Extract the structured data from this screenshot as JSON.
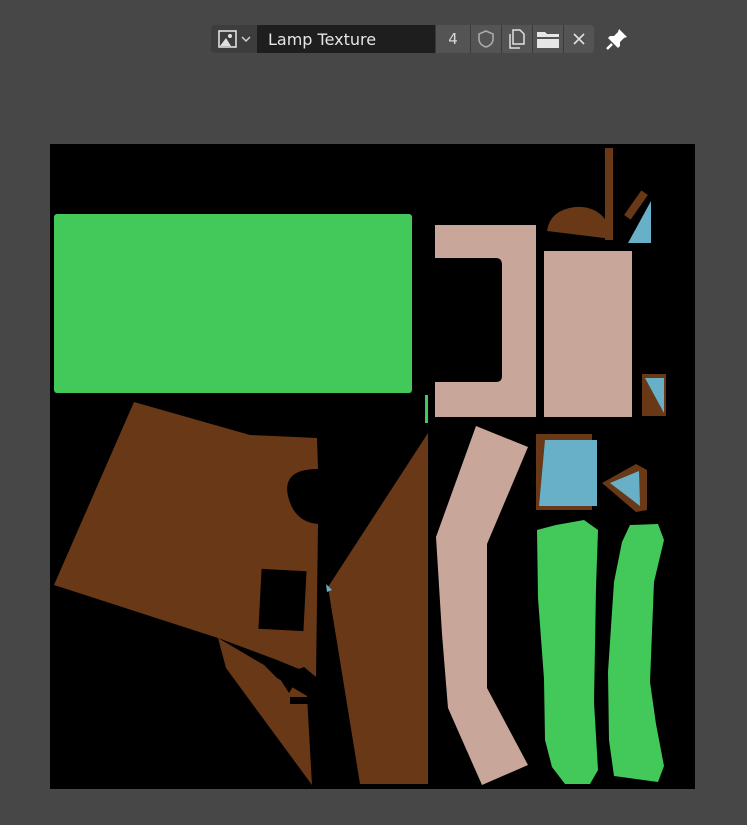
{
  "header": {
    "browse_icon": "image-icon",
    "texture_name": "Lamp Texture",
    "users_count": "4",
    "fake_user_icon": "shield-icon",
    "duplicate_icon": "duplicate-icon",
    "open_icon": "folder-icon",
    "unlink_icon": "close-icon",
    "pin_icon": "pin-icon"
  },
  "colors": {
    "editor_bg": "#474747",
    "texture_bg": "#000000",
    "green": "#43c85a",
    "brown": "#683817",
    "pink": "#c9a69a",
    "blue": "#68b0c8"
  }
}
